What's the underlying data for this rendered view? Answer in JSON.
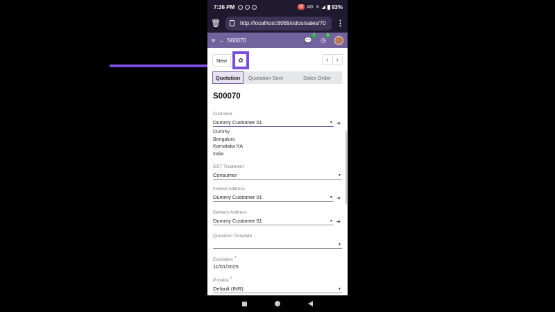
{
  "status_bar": {
    "time": "7:36 PM",
    "notification_count": "10",
    "network_label": "4G",
    "battery": "93%"
  },
  "browser": {
    "url": "http://localhost:8069/odoo/sales/70"
  },
  "odoo_header": {
    "breadcrumb": "S00070",
    "messages_count": "7",
    "activities_count": "5"
  },
  "control_panel": {
    "new_label": "New"
  },
  "status_stages": [
    {
      "label": "Quotation",
      "active": true
    },
    {
      "label": "Quotation Sent",
      "active": false
    },
    {
      "label": "Sales Order",
      "active": false
    }
  ],
  "form": {
    "title": "S00070",
    "customer_label": "Customer",
    "customer_value": "Dummy Customer 01",
    "customer_address": [
      "Dummy",
      "Bengaluru",
      "Karnataka KA",
      "India"
    ],
    "gst_label": "GST Treatment",
    "gst_value": "Consumer",
    "invoice_label": "Invoice Address",
    "invoice_value": "Dummy Customer 01",
    "delivery_label": "Delivery Address",
    "delivery_value": "Dummy Customer 01",
    "template_label": "Quotation Template",
    "template_value": "",
    "expiration_label": "Expiration",
    "expiration_value": "11/01/2025",
    "pricelist_label": "Pricelist",
    "pricelist_value": "Default (INR)",
    "help_mark": "?"
  },
  "highlight_color": "#7a4fe0",
  "brand_color": "#71639e"
}
